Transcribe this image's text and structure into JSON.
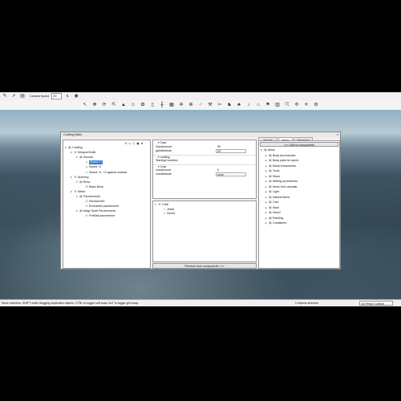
{
  "toolbar": {
    "camera_label": "Camera Speed",
    "camera_speed": "25",
    "icons": [
      "brush-icon",
      "cursor-icon",
      "layers-icon",
      "move-icon",
      "rotate-icon",
      "scale-icon",
      "terrain-icon",
      "water-icon",
      "grid-icon",
      "snowflake-icon",
      "gear-icon",
      "run-icon",
      "hammer-icon",
      "person-icon",
      "creature-icon",
      "trees-icon",
      "sound-icon",
      "house-icon",
      "flag-icon",
      "brick-icon",
      "walk-icon",
      "node-icon",
      "light-icon",
      "settings-icon"
    ]
  },
  "crafting_editor": {
    "title": "Crafting Editor",
    "tree": [
      {
        "label": "Crafting",
        "level": 0,
        "icon": "book-icon"
      },
      {
        "label": "WeaponSmith",
        "level": 1,
        "icon": "hammer-icon"
      },
      {
        "label": "Swords",
        "level": 2,
        "icon": "book-icon"
      },
      {
        "label": "Sword +1",
        "level": 3,
        "icon": "sword-icon",
        "selected": true
      },
      {
        "label": "Sword +2",
        "level": 3,
        "icon": "sword-icon"
      },
      {
        "label": "Sword +2, +3 against undead",
        "level": 3,
        "icon": "sword-icon"
      },
      {
        "label": "Alchemy",
        "level": 1,
        "icon": "hammer-icon"
      },
      {
        "label": "Brew",
        "level": 2,
        "icon": "book-icon"
      },
      {
        "label": "Basic Brew",
        "level": 3,
        "icon": "potion-icon"
      },
      {
        "label": "Writer",
        "level": 1,
        "icon": "hammer-icon"
      },
      {
        "label": "Parchements",
        "level": 2,
        "icon": "book-icon"
      },
      {
        "label": "Parchement",
        "level": 3,
        "icon": "scroll-icon"
      },
      {
        "label": "Enchanted parchement",
        "level": 3,
        "icon": "scroll-icon"
      },
      {
        "label": "Mage Spell Parchements",
        "level": 2,
        "icon": "book-icon"
      },
      {
        "label": "FireBall parchement",
        "level": 3,
        "icon": "scroll-icon"
      }
    ],
    "props": {
      "gain_group": "Gain",
      "gain_amount_label": "GainAmount",
      "gain_amount": "50",
      "gain_attribute_label": "gainAttribute",
      "gain_attribute": "XP",
      "crafting_group": "crafting",
      "starting_condition_label": "StartingCondition",
      "cost_group": "Cost",
      "cost_amount_label": "costAmount",
      "cost_amount": "0",
      "cost_attribute_label": "costAttribute",
      "cost_attribute": "none"
    },
    "components": [
      {
        "label": "Craft",
        "level": 0,
        "icon": "hammer-icon"
      },
      {
        "label": "Jewel",
        "level": 1,
        "icon": "gem-icon"
      },
      {
        "label": "Sword",
        "level": 1,
        "icon": "sword-icon"
      }
    ],
    "remove_button": "Remove from components >>>",
    "tabs": [
      "Armors",
      "Items",
      "Weapons"
    ],
    "add_button": "<<< Add to components",
    "items": [
      "Items",
      "Body Accessories",
      "Body parts for quest",
      "Music instruments",
      "Tools",
      "Stone",
      "Writing accessories",
      "Items from animals",
      "Light",
      "Natural items",
      "Coin",
      "Sack",
      "Insect",
      "Painting",
      "Containers"
    ]
  },
  "status": {
    "hint": "Move selection. SHIFT while dragging duplicates objects. CTRL to toggle soft snap. ALT to toggle grid snap.",
    "count": "0 objects selected",
    "camera_mode": "1st Person Camera"
  }
}
